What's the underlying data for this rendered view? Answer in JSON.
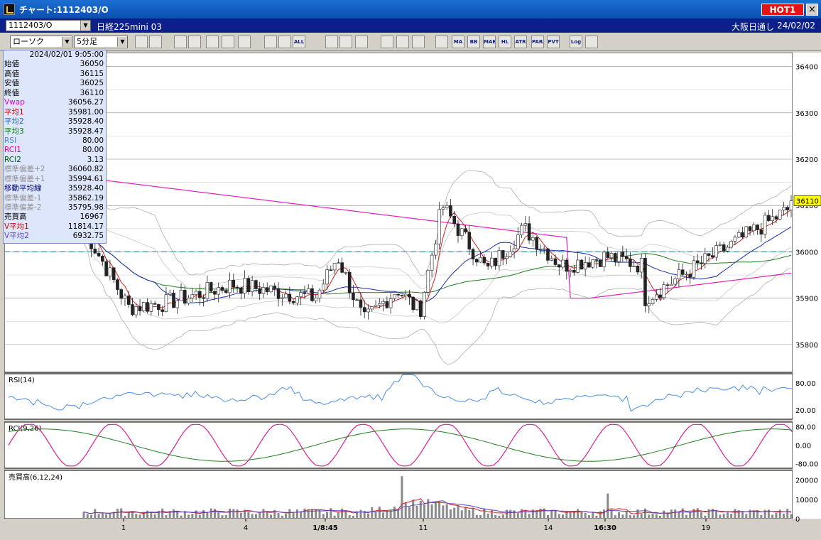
{
  "window": {
    "title": "チャート:1112403/O",
    "hot_label": "HOT1",
    "close_glyph": "×"
  },
  "infobar": {
    "symbol": "1112403/O",
    "symbol_name": "日経225mini 03",
    "market": "大阪日通し",
    "date": "24/02/02"
  },
  "toolbar": {
    "chart_type": "ローソク",
    "timeframe": "5分足",
    "buttons": [
      "zoom-icon",
      "crosshair-icon",
      "period-icon",
      "search-icon",
      "chart-icon",
      "plusminus-icon",
      "draw-icon",
      "candle-icon",
      "compare-icon",
      "all-icon",
      "trend-icon",
      "cursor-icon",
      "undo-icon",
      "grid-icon",
      "wrench-icon",
      "color-icon",
      "ichimoku-icon",
      "ma-icon",
      "bb-icon",
      "mae-icon",
      "hl-icon",
      "atr-icon",
      "para-icon",
      "pvt-icon",
      "log-icon",
      "export-icon"
    ],
    "button_labels": [
      "",
      "",
      "",
      "",
      "",
      "",
      "",
      "",
      "",
      "ALL",
      "",
      "",
      "",
      "",
      "",
      "",
      "",
      "MA",
      "BB",
      "MAE",
      "HL",
      "ATR",
      "PARA",
      "PVT",
      "Log",
      ""
    ]
  },
  "data_panel": {
    "datetime": "2024/02/01 9:05:00",
    "rows": [
      {
        "label": "始値",
        "value": "36050",
        "color": "#000000"
      },
      {
        "label": "高値",
        "value": "36115",
        "color": "#000000"
      },
      {
        "label": "安値",
        "value": "36025",
        "color": "#000000"
      },
      {
        "label": "終値",
        "value": "36110",
        "color": "#000000"
      },
      {
        "label": "Vwap",
        "value": "36056.27",
        "color": "#e000e0"
      },
      {
        "label": "平均1",
        "value": "35981.00",
        "color": "#d00000"
      },
      {
        "label": "平均2",
        "value": "35928.40",
        "color": "#2060c0"
      },
      {
        "label": "平均3",
        "value": "35928.47",
        "color": "#008000"
      },
      {
        "label": "RSI",
        "value": "80.00",
        "color": "#5080ff"
      },
      {
        "label": "RCI1",
        "value": "80.00",
        "color": "#e000a0"
      },
      {
        "label": "RCI2",
        "value": "3.13",
        "color": "#006000"
      },
      {
        "label": "標準偏差+2",
        "value": "36060.82",
        "color": "#909090"
      },
      {
        "label": "標準偏差+1",
        "value": "35994.61",
        "color": "#909090"
      },
      {
        "label": "移動平均線",
        "value": "35928.40",
        "color": "#000080"
      },
      {
        "label": "標準偏差-1",
        "value": "35862.19",
        "color": "#909090"
      },
      {
        "label": "標準偏差-2",
        "value": "35795.98",
        "color": "#909090"
      },
      {
        "label": "売買高",
        "value": "16967",
        "color": "#000000"
      },
      {
        "label": "V平均1",
        "value": "11814.17",
        "color": "#d00000"
      },
      {
        "label": "V平均2",
        "value": "6932.75",
        "color": "#6040c0"
      }
    ]
  },
  "price_chart": {
    "price_ticks": [
      "36400",
      "36300",
      "36200",
      "36100",
      "36000",
      "35900",
      "35800"
    ],
    "current_price": "36110",
    "reference_price": 36000
  },
  "rsi_panel": {
    "label": "RSI(14)",
    "ticks": [
      "80.00",
      "20.00"
    ]
  },
  "rci_panel": {
    "label": "RCI(9,26)",
    "ticks": [
      "80.00",
      "0.00",
      "-80.00"
    ]
  },
  "volume_panel": {
    "label": "売買高(6,12,24)",
    "ticks": [
      "20000",
      "10000",
      "0"
    ]
  },
  "x_axis": {
    "labels": [
      "1",
      "4",
      "1/8:45",
      "11",
      "14",
      "16:30",
      "19"
    ]
  },
  "chart_data": {
    "type": "line",
    "price_range": [
      35740,
      36430
    ],
    "rsi_range": [
      0,
      100
    ],
    "rci_range": [
      -100,
      100
    ],
    "volume_range": [
      0,
      25000
    ]
  }
}
